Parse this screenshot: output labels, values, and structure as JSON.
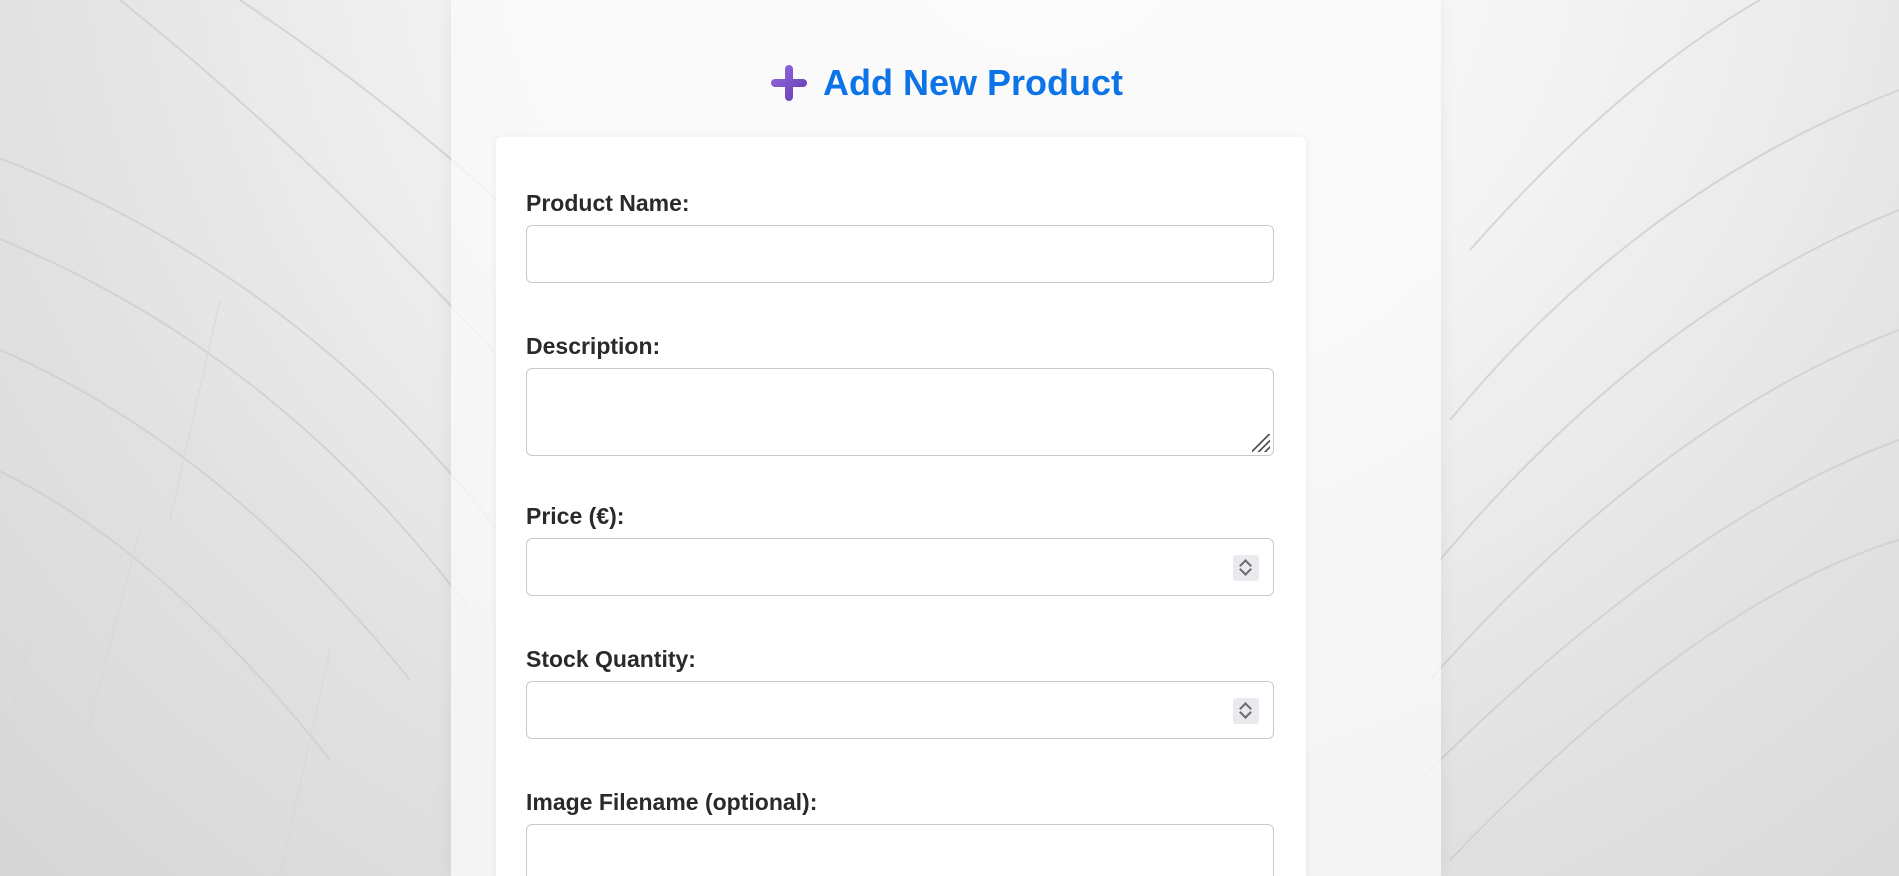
{
  "page": {
    "title": "Add New Product",
    "title_icon": "plus-icon",
    "accent_color": "#0d74e8",
    "icon_color": "#7b52c9"
  },
  "form": {
    "product_name": {
      "label": "Product Name:",
      "value": "",
      "placeholder": ""
    },
    "description": {
      "label": "Description:",
      "value": "",
      "placeholder": ""
    },
    "price": {
      "label": "Price (€):",
      "value": "",
      "placeholder": ""
    },
    "stock_quantity": {
      "label": "Stock Quantity:",
      "value": "",
      "placeholder": ""
    },
    "image_filename": {
      "label": "Image Filename (optional):",
      "value": "",
      "placeholder": ""
    }
  }
}
